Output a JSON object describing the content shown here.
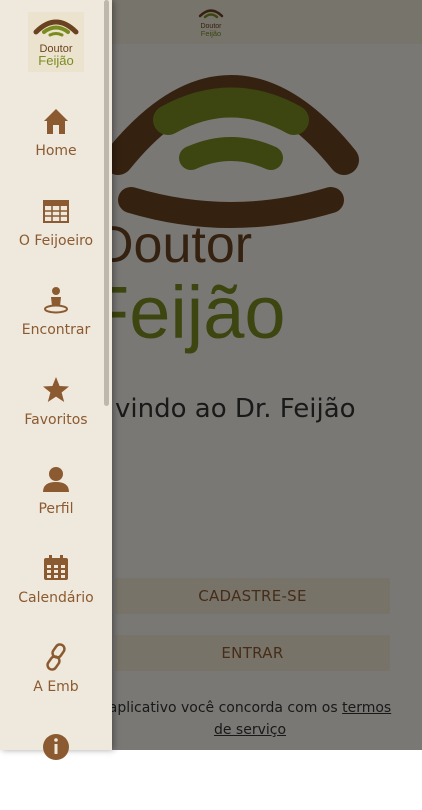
{
  "app": {
    "name_line1": "Doutor",
    "name_line2": "Feijão"
  },
  "colors": {
    "brown": "#6b4220",
    "green": "#7a8c20",
    "label": "#8b5a30",
    "drawer_bg": "#efe8dc"
  },
  "main": {
    "welcome": "vindo ao Dr. Feijão",
    "register_label": "CADASTRE-SE",
    "login_label": "ENTRAR",
    "terms_prefix": "aplicativo você concorda com os ",
    "terms_link": "termos de serviço"
  },
  "drawer": {
    "items": [
      {
        "label": "Home",
        "icon": "home-icon"
      },
      {
        "label": "O Feijoeiro",
        "icon": "table-icon"
      },
      {
        "label": "Encontrar",
        "icon": "person-pin-icon"
      },
      {
        "label": "Favoritos",
        "icon": "star-icon"
      },
      {
        "label": "Perfil",
        "icon": "user-icon"
      },
      {
        "label": "Calendário",
        "icon": "calendar-icon"
      },
      {
        "label": "A Emb",
        "icon": "link-icon"
      },
      {
        "label": "",
        "icon": "info-icon"
      }
    ]
  }
}
